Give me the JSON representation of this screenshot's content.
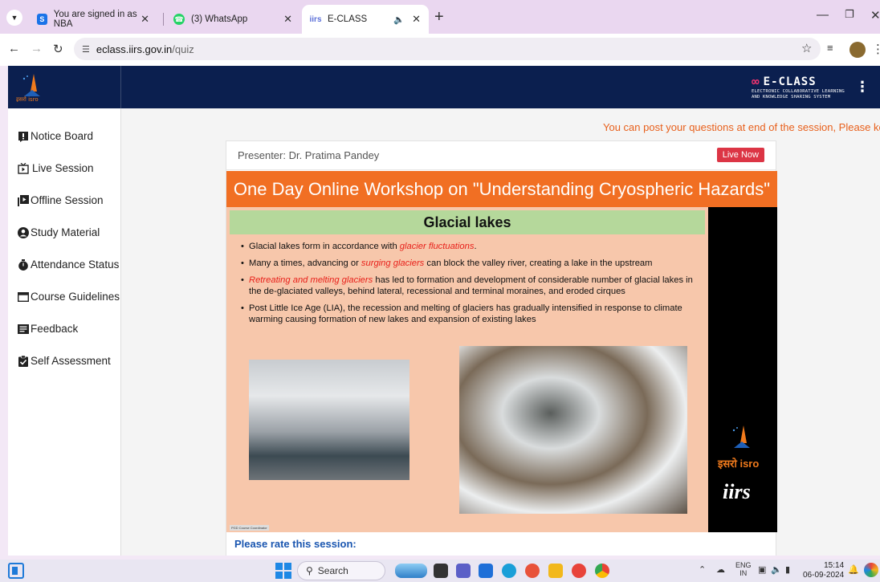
{
  "browser": {
    "tabs": [
      {
        "title": "You are signed in as NBA",
        "favicon": "S",
        "favicon_color": "#1a73e8"
      },
      {
        "title": "(3) WhatsApp",
        "favicon": "whatsapp-icon",
        "favicon_color": "#25d366"
      },
      {
        "title": "E-CLASS",
        "favicon": "iirs",
        "favicon_color": "#5b6fd8",
        "active": true
      }
    ],
    "url_host": "eclass.iirs.gov.in",
    "url_path": "/quiz"
  },
  "header": {
    "eclass_logo": "E-CLASS",
    "eclass_tagline_line1": "ELECTRONIC COLLABORATIVE LEARNING",
    "eclass_tagline_line2": "AND KNOWLEDGE SHARING SYSTEM",
    "isro_logo_text": "इसरो isro"
  },
  "sidebar": {
    "items": [
      {
        "label": "Notice Board",
        "icon": "notice-icon"
      },
      {
        "label": "Live Session",
        "icon": "live-tv-icon"
      },
      {
        "label": "Offline Session",
        "icon": "play-icon"
      },
      {
        "label": "Study Material",
        "icon": "user-circle-icon"
      },
      {
        "label": "Attendance Status",
        "icon": "stopwatch-icon"
      },
      {
        "label": "Course Guidelines",
        "icon": "window-icon"
      },
      {
        "label": "Feedback",
        "icon": "feedback-icon"
      },
      {
        "label": "Self Assessment",
        "icon": "clipboard-check-icon"
      }
    ]
  },
  "main": {
    "marquee": "You can post your questions at end of the session, Please ke",
    "presenter": "Presenter: Dr. Pratima Pandey",
    "live_badge": "Live Now",
    "rate_prompt": "Please rate this session:"
  },
  "slide": {
    "banner": "One Day Online Workshop on \"Understanding Cryospheric Hazards\"",
    "heading": "Glacial lakes",
    "bullet1_pre": "Glacial lakes form in accordance with ",
    "bullet1_hl": "glacier fluctuations",
    "bullet1_post": ".",
    "bullet2_pre": "Many a times, advancing or ",
    "bullet2_hl": "surging glaciers",
    "bullet2_post": " can block the valley river, creating a lake in the upstream",
    "bullet3_hl": "Retreating and melting glaciers",
    "bullet3_post": " has led to formation and development of considerable number of glacial lakes in the de-glaciated valleys, behind lateral, recessional and terminal moraines, and eroded cirques",
    "bullet4": "Post Little Ice Age (LIA), the recession and melting of glaciers has gradually intensified in response to climate warming causing formation of new lakes and expansion of existing lakes",
    "caption": "PGD Course Coordinator",
    "isro_text": "इसरो isro",
    "iirs_text": "iirs"
  },
  "taskbar": {
    "search_label": "Search",
    "lang_line1": "ENG",
    "lang_line2": "IN",
    "time": "15:14",
    "date": "06-09-2024"
  },
  "colors": {
    "header_bg": "#0b1f4f",
    "banner_orange": "#f16f23",
    "live_red": "#dc3545",
    "marquee_orange": "#e8601c",
    "rate_blue": "#1a56b0"
  }
}
